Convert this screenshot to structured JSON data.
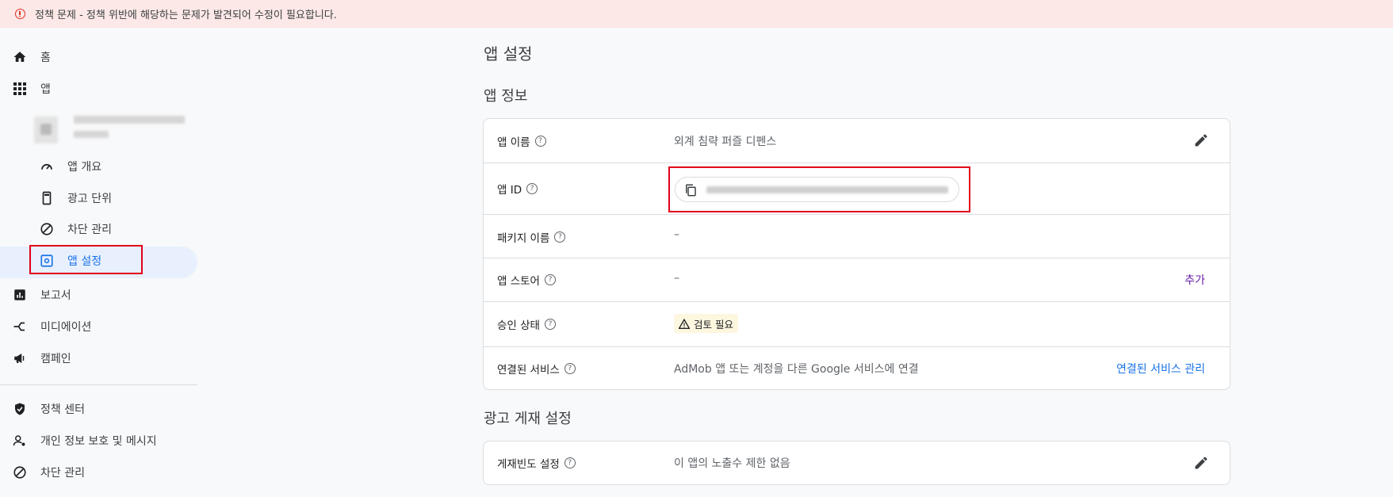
{
  "banner": {
    "text": "정책 문제 - 정책 위반에 해당하는 문제가 발견되어 수정이 필요합니다."
  },
  "sidebar": {
    "home": "홈",
    "apps": "앱",
    "app_overview": "앱 개요",
    "ad_units": "광고 단위",
    "blocking": "차단 관리",
    "app_settings": "앱 설정",
    "reports": "보고서",
    "mediation": "미디에이션",
    "campaigns": "캠페인",
    "policy_center": "정책 센터",
    "privacy": "개인 정보 보호 및 메시지",
    "blocking2": "차단 관리"
  },
  "main": {
    "page_title": "앱 설정",
    "app_info_title": "앱 정보",
    "rows": {
      "app_name": {
        "label": "앱 이름",
        "value": "외계 침략 퍼즐 디펜스"
      },
      "app_id": {
        "label": "앱 ID"
      },
      "package": {
        "label": "패키지 이름",
        "value": "–"
      },
      "store": {
        "label": "앱 스토어",
        "value": "–",
        "action": "추가"
      },
      "approval": {
        "label": "승인 상태",
        "badge": "검토 필요"
      },
      "linked": {
        "label": "연결된 서비스",
        "value": "AdMob 앱 또는 계정을 다른 Google 서비스에 연결",
        "action": "연결된 서비스 관리"
      }
    },
    "ad_serving_title": "광고 게재 설정",
    "frequency": {
      "label": "게재빈도 설정",
      "value": "이 앱의 노출수 제한 없음"
    }
  },
  "colors": {
    "accent": "#1a73e8",
    "error": "#d93025",
    "highlight": "#e0001b",
    "banner_bg": "#fce8e6"
  }
}
